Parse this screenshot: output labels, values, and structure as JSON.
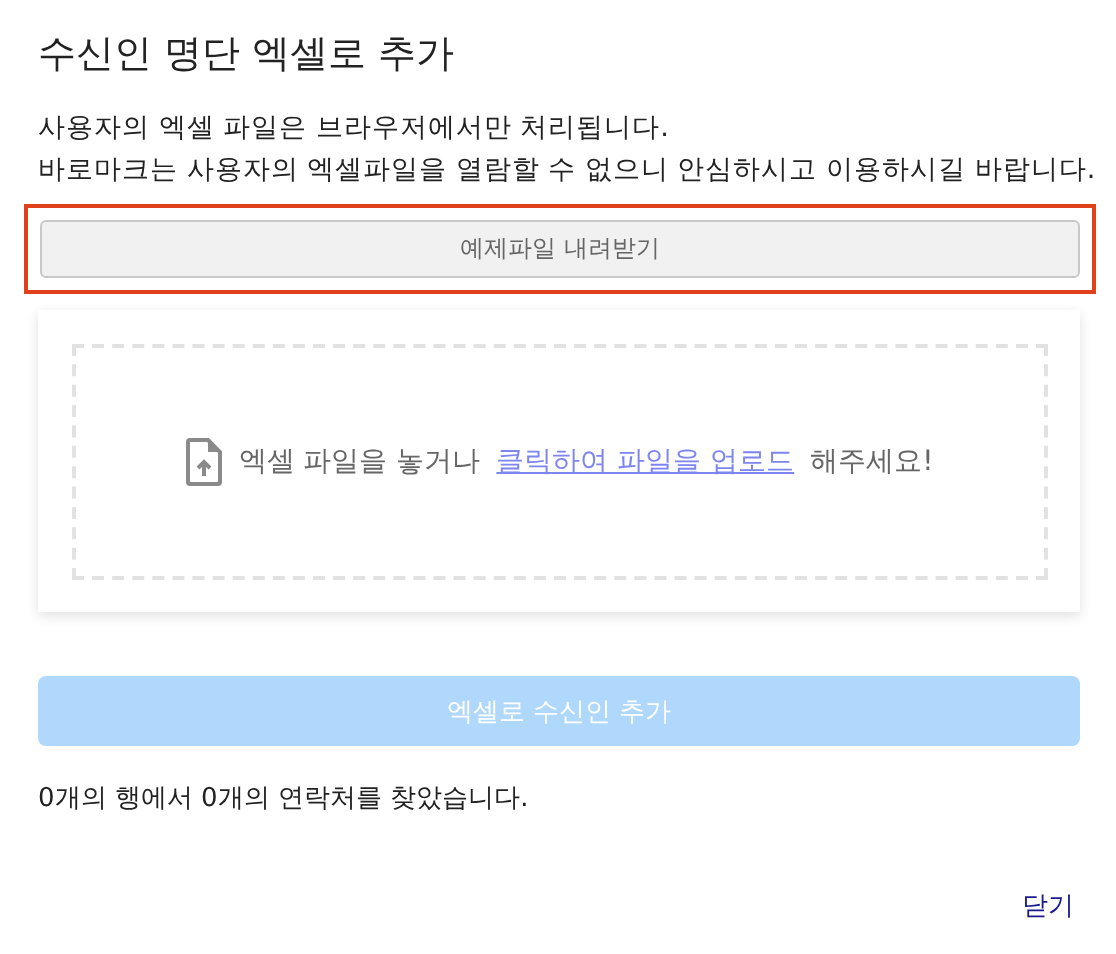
{
  "dialog": {
    "title": "수신인 명단 엑셀로 추가"
  },
  "description": [
    "사용자의 엑셀 파일은 브라우저에서만 처리됩니다.",
    "바로마크는 사용자의 엑셀파일을 열람할 수 없으니 안심하시고 이용하시길 바랍니다."
  ],
  "download_button": {
    "label": "예제파일 내려받기",
    "highlighted": true
  },
  "drop_zone": {
    "text_before": "엑셀 파일을 놓거나",
    "link": "클릭하여 파일을 업로드",
    "text_after": "해주세요!"
  },
  "add_button": {
    "label": "엑셀로 수신인 추가",
    "disabled": true
  },
  "status": "0개의 행에서 0개의 연락처를 찾았습니다.",
  "close_link": "닫기"
}
